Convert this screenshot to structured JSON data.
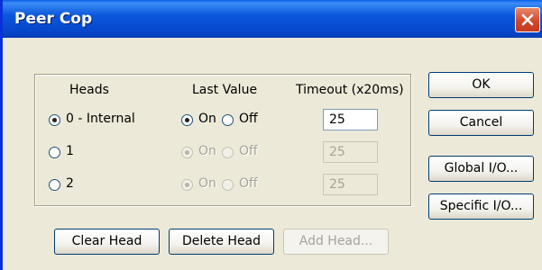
{
  "window": {
    "title": "Peer Cop",
    "close_icon": "close-icon"
  },
  "headers": {
    "heads": "Heads",
    "last_value": "Last Value",
    "timeout": "Timeout (x20ms)"
  },
  "rows": [
    {
      "head_label": "0 - Internal",
      "head_selected": true,
      "on_label": "On",
      "off_label": "Off",
      "value_on": true,
      "timeout": "25",
      "enabled": true
    },
    {
      "head_label": "1",
      "head_selected": false,
      "on_label": "On",
      "off_label": "Off",
      "value_on": true,
      "timeout": "25",
      "enabled": false
    },
    {
      "head_label": "2",
      "head_selected": false,
      "on_label": "On",
      "off_label": "Off",
      "value_on": true,
      "timeout": "25",
      "enabled": false
    }
  ],
  "buttons": {
    "ok": "OK",
    "cancel": "Cancel",
    "global_io": "Global I/O...",
    "specific_io": "Specific I/O...",
    "clear_head": "Clear Head",
    "delete_head": "Delete Head",
    "add_head": "Add Head..."
  },
  "colors": {
    "title_bar": "#0b58dc",
    "dialog_bg": "#ece9d8",
    "close_button": "#d4472a",
    "disabled_text": "#a6a39a"
  }
}
